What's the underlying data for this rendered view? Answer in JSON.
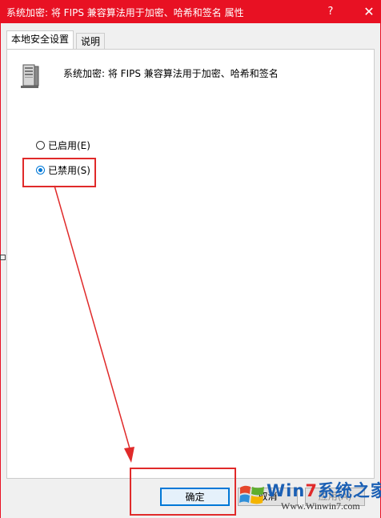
{
  "window": {
    "title": "系统加密: 将 FIPS 兼容算法用于加密、哈希和签名 属性",
    "help_label": "?",
    "close_label": "✕",
    "accent_color": "#e81123"
  },
  "tabs": [
    {
      "label": "本地安全设置",
      "active": true
    },
    {
      "label": "说明",
      "active": false
    }
  ],
  "policy": {
    "icon": "server-icon",
    "description": "系统加密: 将 FIPS 兼容算法用于加密、哈希和签名"
  },
  "options": [
    {
      "label": "已启用(E)",
      "checked": false
    },
    {
      "label": "已禁用(S)",
      "checked": true
    }
  ],
  "buttons": {
    "ok": "确定",
    "cancel": "取消",
    "apply": "应用(A)"
  },
  "annotation": {
    "highlight_color": "#e02a2a"
  },
  "watermark": {
    "brand_prefix": "Win",
    "brand_seven": "7",
    "brand_suffix": "系统之家",
    "url": "Www.Winwin7.com"
  }
}
